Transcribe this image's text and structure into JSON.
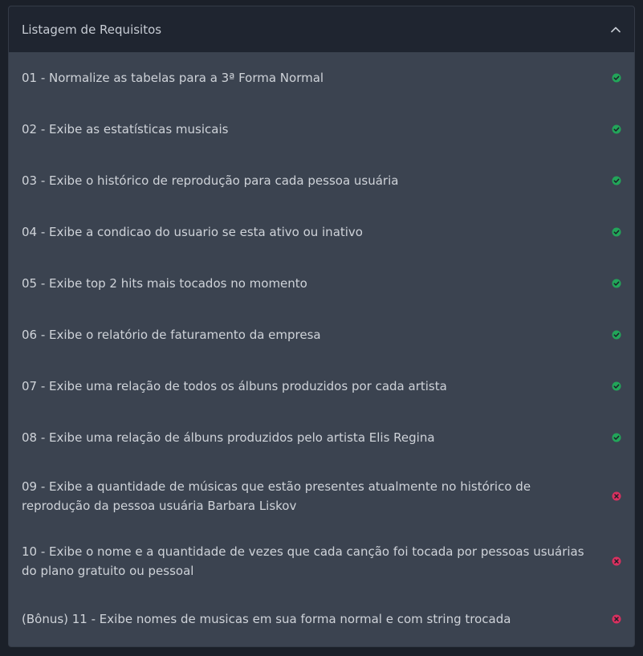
{
  "panel": {
    "title": "Listagem de Requisitos",
    "collapse_icon": "chevron-up-icon"
  },
  "colors": {
    "pass": "#22a559",
    "fail": "#d9305f"
  },
  "requirements": [
    {
      "label": "01 - Normalize as tabelas para a 3ª Forma Normal",
      "status": "pass",
      "icon": "check-circle-icon"
    },
    {
      "label": "02 - Exibe as estatísticas musicais",
      "status": "pass",
      "icon": "check-circle-icon"
    },
    {
      "label": "03 - Exibe o histórico de reprodução para cada pessoa usuária",
      "status": "pass",
      "icon": "check-circle-icon"
    },
    {
      "label": "04 - Exibe a condicao do usuario se esta ativo ou inativo",
      "status": "pass",
      "icon": "check-circle-icon"
    },
    {
      "label": "05 - Exibe top 2 hits mais tocados no momento",
      "status": "pass",
      "icon": "check-circle-icon"
    },
    {
      "label": "06 - Exibe o relatório de faturamento da empresa",
      "status": "pass",
      "icon": "check-circle-icon"
    },
    {
      "label": "07 - Exibe uma relação de todos os álbuns produzidos por cada artista",
      "status": "pass",
      "icon": "check-circle-icon"
    },
    {
      "label": "08 - Exibe uma relação de álbuns produzidos pelo artista Elis Regina",
      "status": "pass",
      "icon": "check-circle-icon"
    },
    {
      "label": "09 - Exibe a quantidade de músicas que estão presentes atualmente no histórico de reprodução da pessoa usuária Barbara Liskov",
      "status": "fail",
      "icon": "x-circle-icon"
    },
    {
      "label": "10 - Exibe o nome e a quantidade de vezes que cada canção foi tocada por pessoas usuárias do plano gratuito ou pessoal",
      "status": "fail",
      "icon": "x-circle-icon"
    },
    {
      "label": "(Bônus) 11 - Exibe nomes de musicas em sua forma normal e com string trocada",
      "status": "fail",
      "icon": "x-circle-icon"
    }
  ]
}
